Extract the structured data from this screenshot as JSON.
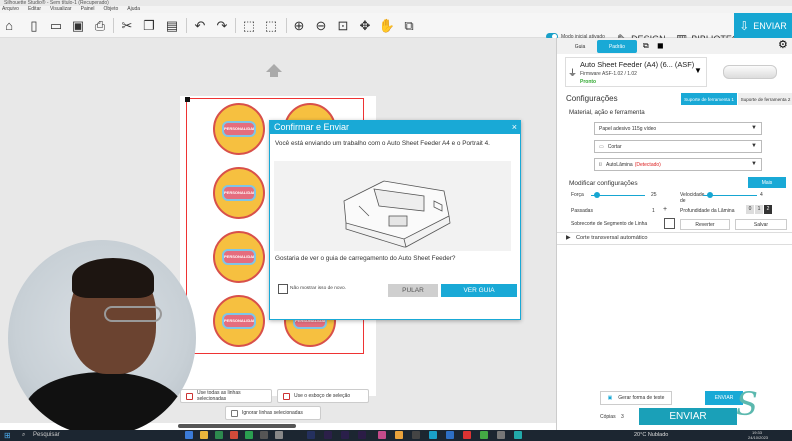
{
  "window": {
    "title": "Silhouette Studio® - Sem título-1 (Recuperado)"
  },
  "menu": [
    "Arquivo",
    "Editar",
    "Visualizar",
    "Painel",
    "Objeto",
    "Ajuda"
  ],
  "top": {
    "toggle_label": "Modo inicial ativado",
    "tabs": [
      {
        "label": "DESIGN",
        "icon": "design-icon"
      },
      {
        "label": "BIBLIOTECA",
        "icon": "library-icon"
      },
      {
        "label": "ENVIAR",
        "icon": "send-icon"
      }
    ]
  },
  "dialog": {
    "title": "Confirmar e Enviar",
    "message": "Você está enviando um trabalho com o Auto Sheet Feeder A4 e o Portrait 4.",
    "question": "Gostaria de ver o guia de carregamento do Auto Sheet Feeder?",
    "checkbox_label": "Não mostrar isso de novo.",
    "skip_label": "PULAR",
    "guide_label": "VER GUIA"
  },
  "stickers": {
    "text": "PERSONALIDADES"
  },
  "canvas_buttons": {
    "select_all_lines": "Use todas as linhas selecionadas",
    "use_sketch": "Use o esboço de seleção",
    "ignore_lines": "Ignorar linhas selecionadas"
  },
  "panel": {
    "tabs": [
      "Guia",
      "Padrão"
    ],
    "machine": {
      "name": "Auto Sheet Feeder (A4) (6... (ASF)",
      "firmware": "Firmware ASF-1.02 / 1.02",
      "status": "Pronto"
    },
    "settings_title": "Configurações",
    "sub_tabs": [
      "Suporte de ferramenta 1",
      "Suporte de ferramenta 2"
    ],
    "material_title": "Material, ação e ferramenta",
    "material": "Papel adesivo 115g vídeo",
    "action": "Cortar",
    "tool": "AutoLâmina",
    "tool_status": "(Detectado)",
    "modify_title": "Modificar configurações",
    "more_label": "Mais",
    "force_label": "Força",
    "force_value": "25",
    "speed_label": "Velocidade",
    "speed_label_2": "de",
    "speed_value": "4",
    "passes_label": "Passadas",
    "passes_value": "1",
    "depth_label": "Profundidade da Lâmina",
    "depth_values": [
      "0",
      "1",
      "2"
    ],
    "overcut_label": "Sobrecorte de Segmento de Linha",
    "revert_label": "Reverter",
    "save_label": "Salvar",
    "transverse_label": "Corte transversal automático",
    "test_label": "Gerar forma de teste",
    "test_send_label": "ENVIAR",
    "copies_label": "Cópias",
    "copies_value": "3",
    "send_label": "ENVIAR"
  },
  "taskbar": {
    "search_placeholder": "Pesquisar",
    "weather": "20°C  Nublado",
    "time": "19:33",
    "date": "24/10/2023"
  },
  "colors": {
    "accent": "#19a9d6",
    "cut_line": "#ee3333",
    "sticker_fill": "#f6c040"
  }
}
